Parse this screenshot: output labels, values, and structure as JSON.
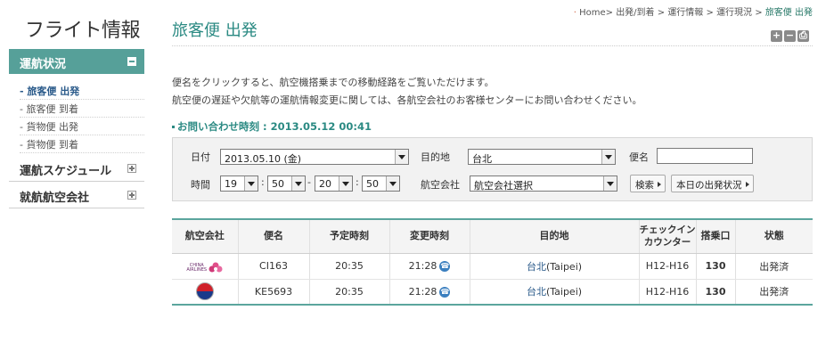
{
  "sidebar": {
    "title": "フライト情報",
    "active_menu": "運航状況",
    "sub_items": [
      "- 旅客便 出発",
      "- 旅客便 到着",
      "- 貨物便 出発",
      "- 貨物便 到着"
    ],
    "menus": [
      "運航スケジュール",
      "就航航空会社"
    ]
  },
  "breadcrumb": {
    "items": [
      "Home",
      "出発/到着",
      "運行情報",
      "運行現況"
    ],
    "current": "旅客便 出発"
  },
  "page": {
    "title": "旅客便 出発",
    "intro_line1": "便名をクリックすると、航空機搭乗までの移動経路をご覧いただけます。",
    "intro_line2": "航空便の遅延や欠航等の運航情報変更に関しては、各航空会社のお客様センターにお問い合わせください。",
    "query_time": "お問い合わせ時刻 : 2013.05.12 00:41"
  },
  "search": {
    "date_label": "日付",
    "date_value": "2013.05.10 (金)",
    "dest_label": "目的地",
    "dest_value": "台北",
    "flight_label": "便名",
    "flight_value": "",
    "time_label": "時間",
    "time_values": [
      "19",
      "50",
      "20",
      "50"
    ],
    "time_sep_colon": ":",
    "time_sep_dash": "-",
    "airline_label": "航空会社",
    "airline_value": "航空会社選択",
    "search_button": "検索",
    "today_button": "本日の出発状況"
  },
  "table": {
    "headers": [
      "航空会社",
      "便名",
      "予定時刻",
      "変更時刻",
      "目的地",
      "チェックイン\nカウンター",
      "搭乗口",
      "状態"
    ],
    "rows": [
      {
        "airline": "China Airlines",
        "logo_text": "CHINA\nAIRLINES",
        "flight": "CI163",
        "scheduled": "20:35",
        "changed": "21:28",
        "dest_city": "台北",
        "dest_en": "(Taipei)",
        "counter": "H12-H16",
        "gate": "130",
        "status": "出発済"
      },
      {
        "airline": "Korean Air",
        "logo_text": "",
        "flight": "KE5693",
        "scheduled": "20:35",
        "changed": "21:28",
        "dest_city": "台北",
        "dest_en": "(Taipei)",
        "counter": "H12-H16",
        "gate": "130",
        "status": "出発済"
      }
    ]
  },
  "colors": {
    "accent": "#56a099",
    "title": "#2b8a83",
    "link": "#2a5a8a"
  }
}
